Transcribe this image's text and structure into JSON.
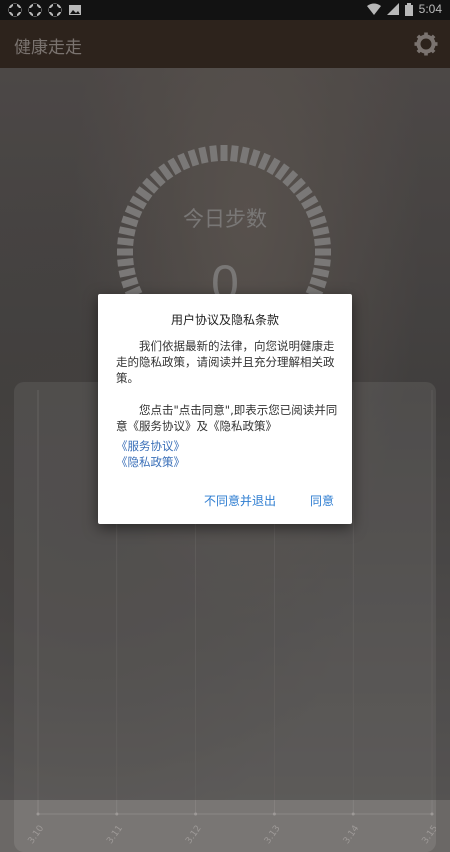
{
  "status_bar": {
    "time": "5:04"
  },
  "app": {
    "title": "健康走走",
    "settings_icon": "gear-icon"
  },
  "main": {
    "steps_label": "今日步数",
    "steps_value": "0"
  },
  "chart_data": {
    "type": "line",
    "categories": [
      "3.10",
      "3.11",
      "3.12",
      "3.13",
      "3.14",
      "3.15"
    ],
    "values": [
      0,
      0,
      0,
      0,
      0,
      0
    ]
  },
  "dialog": {
    "title": "用户协议及隐私条款",
    "paragraph1": "我们依据最新的法律，向您说明健康走走的隐私政策，请阅读并且充分理解相关政策。",
    "paragraph2": "您点击\"点击同意\",即表示您已阅读并同意《服务协议》及《隐私政策》",
    "link_service": "《服务协议》",
    "link_privacy": "《隐私政策》",
    "decline_label": "不同意并退出",
    "agree_label": "同意"
  }
}
